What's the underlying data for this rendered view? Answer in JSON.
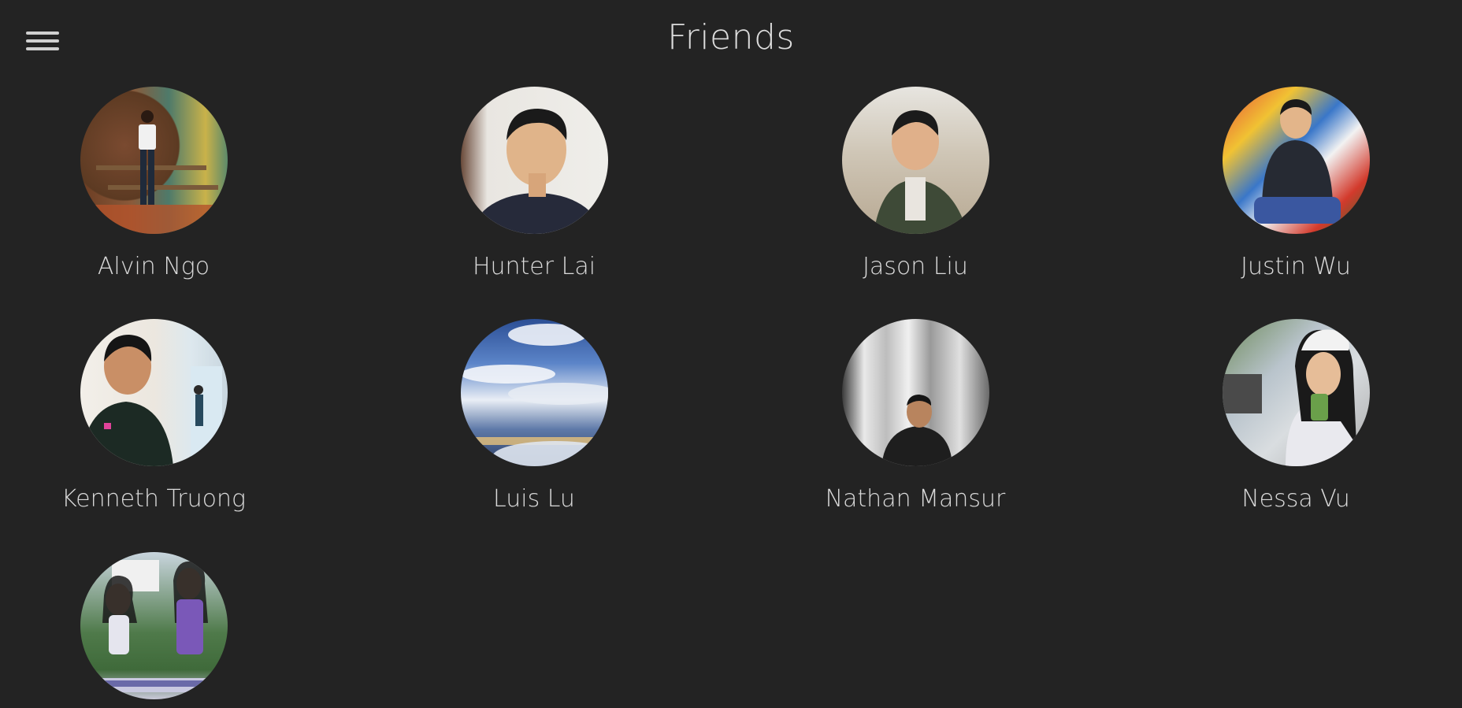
{
  "header": {
    "title": "Friends",
    "menu_icon": "hamburger-menu-icon"
  },
  "friends": [
    {
      "name": "Alvin Ngo",
      "avatar_icon": "avatar-photo"
    },
    {
      "name": "Hunter Lai",
      "avatar_icon": "avatar-photo"
    },
    {
      "name": "Jason Liu",
      "avatar_icon": "avatar-photo"
    },
    {
      "name": "Justin Wu",
      "avatar_icon": "avatar-photo"
    },
    {
      "name": "Kenneth Truong",
      "avatar_icon": "avatar-photo"
    },
    {
      "name": "Luis Lu",
      "avatar_icon": "avatar-photo"
    },
    {
      "name": "Nathan Mansur",
      "avatar_icon": "avatar-photo"
    },
    {
      "name": "Nessa Vu",
      "avatar_icon": "avatar-photo"
    },
    {
      "name": "",
      "avatar_icon": "avatar-photo"
    }
  ],
  "colors": {
    "background": "#232323",
    "text": "#dadada"
  }
}
